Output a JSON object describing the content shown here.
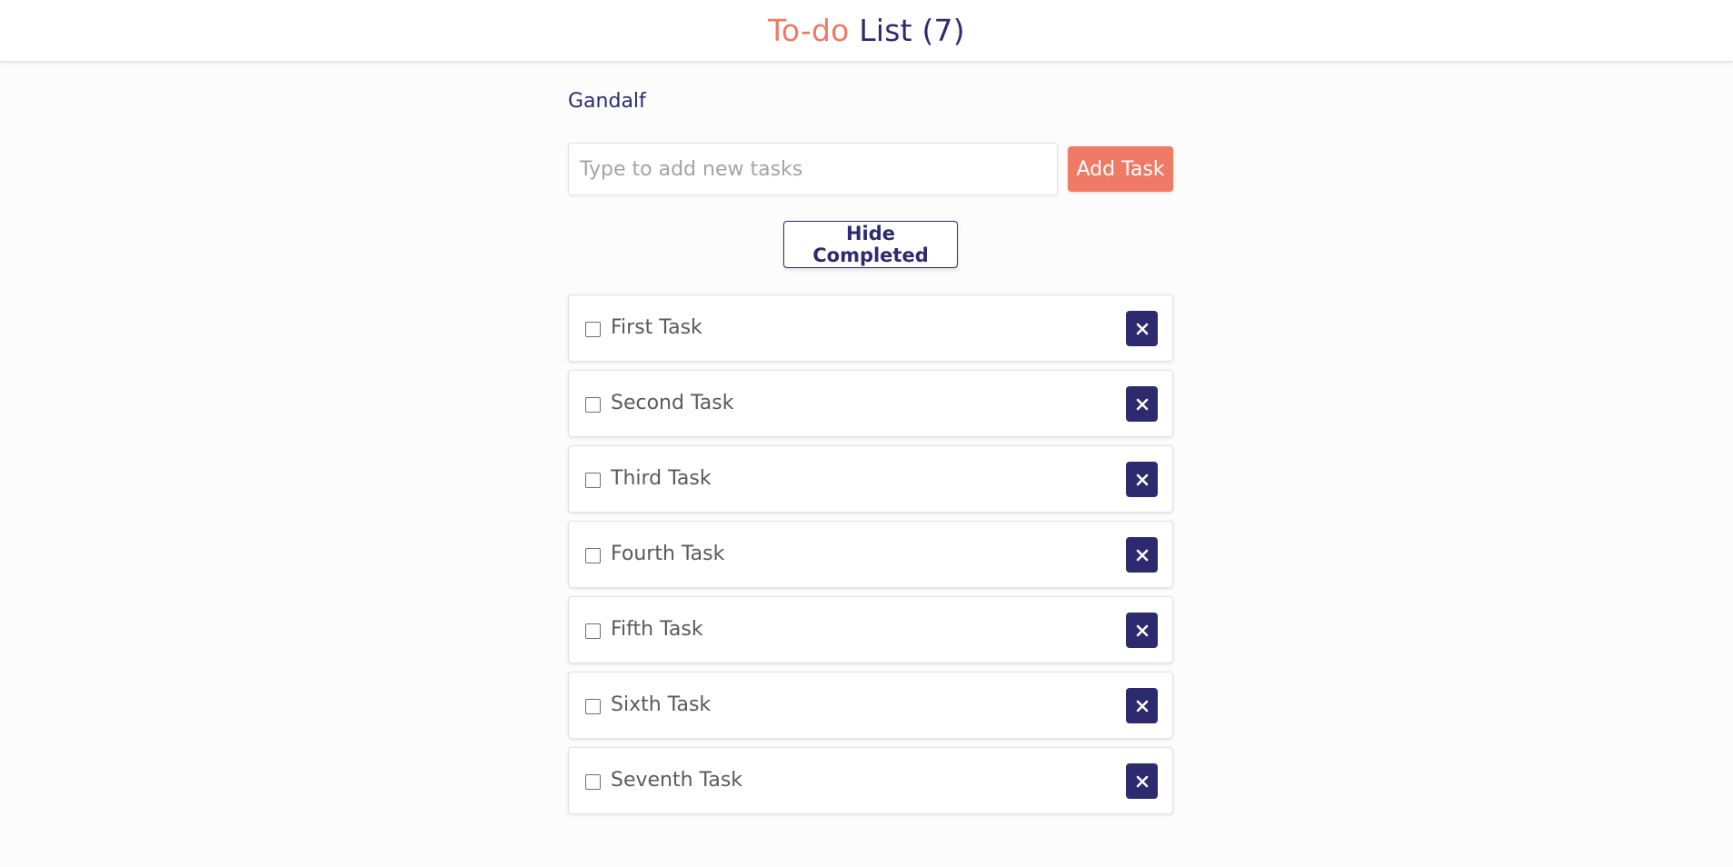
{
  "header": {
    "title_accent": "To-do",
    "title_rest": "List (7)"
  },
  "user": {
    "name": "Gandalf"
  },
  "add_task": {
    "placeholder": "Type to add new tasks",
    "value": "",
    "button_label": "Add Task"
  },
  "filter": {
    "hide_completed_label": "Hide Completed"
  },
  "tasks": [
    {
      "label": "First Task",
      "completed": false
    },
    {
      "label": "Second Task",
      "completed": false
    },
    {
      "label": "Third Task",
      "completed": false
    },
    {
      "label": "Fourth Task",
      "completed": false
    },
    {
      "label": "Fifth Task",
      "completed": false
    },
    {
      "label": "Sixth Task",
      "completed": false
    },
    {
      "label": "Seventh Task",
      "completed": false
    }
  ],
  "icons": {
    "delete": "close-icon",
    "checkbox": "checkbox-icon"
  },
  "colors": {
    "accent": "#ef7a66",
    "primary": "#2d2b6e",
    "text": "#5a5a5a"
  }
}
